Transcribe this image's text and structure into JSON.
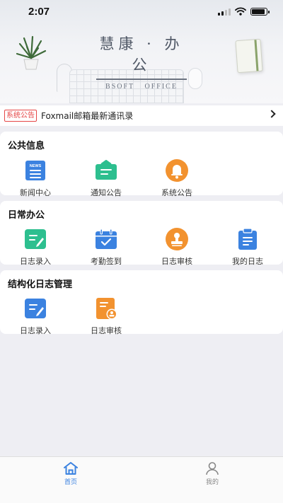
{
  "status_bar": {
    "time": "2:07",
    "battery_level": 0.9
  },
  "banner": {
    "title": "慧康 · 办公",
    "subtitle": "BSOFT  OFFICE"
  },
  "notice": {
    "tag": "系统公告",
    "text": "Foxmail邮箱最新通讯录",
    "icon": "chevron-right-icon"
  },
  "public_info": {
    "title": "公共信息",
    "items": [
      {
        "label": "新闻中心",
        "icon": "news-icon",
        "icon_text": "NEWS",
        "color": "#3b82e0"
      },
      {
        "label": "通知公告",
        "icon": "notice-icon",
        "color": "#2dbf8f"
      },
      {
        "label": "系统公告",
        "icon": "bell-icon",
        "color": "#f2922f"
      }
    ]
  },
  "daily_office": {
    "title": "日常办公",
    "items": [
      {
        "label": "日志录入",
        "icon": "log-entry-icon",
        "color": "#2dbf8f"
      },
      {
        "label": "考勤签到",
        "icon": "calendar-check-icon",
        "color": "#3b82e0"
      },
      {
        "label": "日志审核",
        "icon": "stamp-icon",
        "color": "#f2922f"
      },
      {
        "label": "我的日志",
        "icon": "clipboard-icon",
        "color": "#3b82e0"
      }
    ]
  },
  "structured_log": {
    "title": "结构化日志管理",
    "items": [
      {
        "label": "日志录入",
        "icon": "log-entry-icon",
        "color": "#3b82e0"
      },
      {
        "label": "日志审核",
        "icon": "log-review-icon",
        "color": "#f2922f"
      }
    ]
  },
  "tabbar": {
    "tabs": [
      {
        "label": "首页",
        "icon": "home-icon",
        "active": true,
        "color": "#3b82e0"
      },
      {
        "label": "我的",
        "icon": "user-icon",
        "active": false,
        "color": "#888888"
      }
    ]
  }
}
